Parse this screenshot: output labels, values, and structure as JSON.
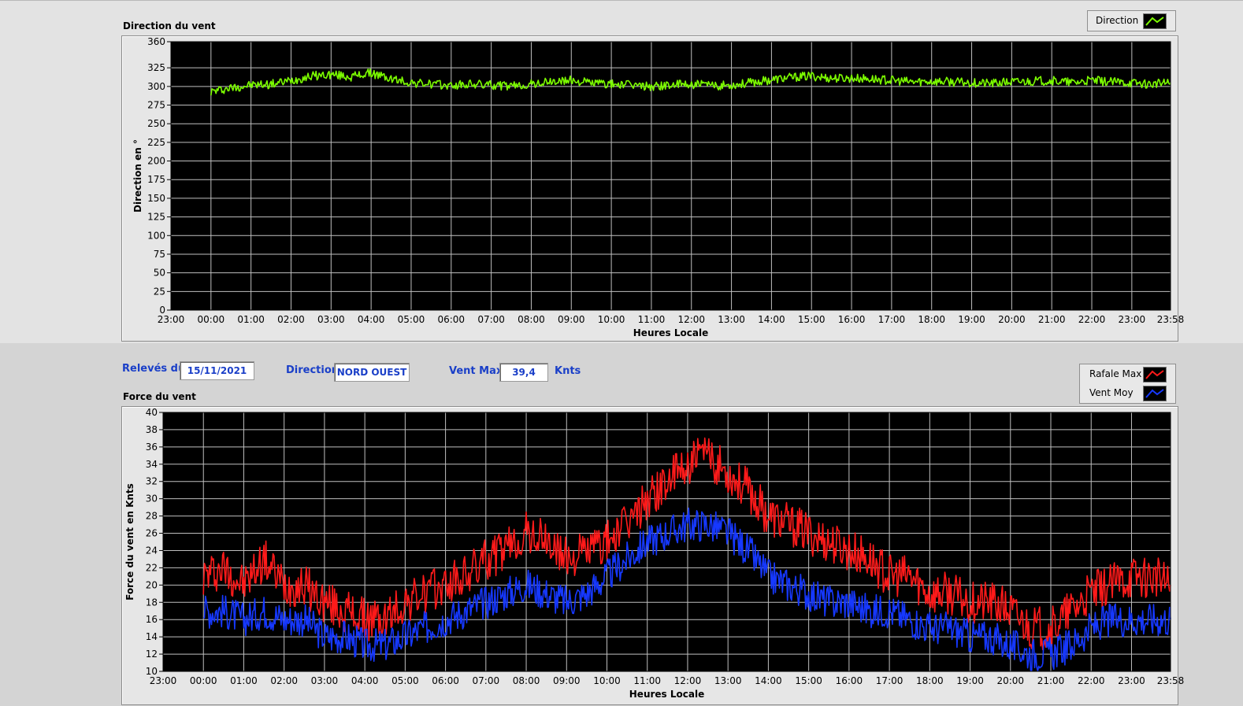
{
  "info": {
    "releves_label": "Relevés du",
    "date_value": "15/11/2021",
    "direction_label": "Direction",
    "direction_value": "NORD OUEST",
    "ventmax_label": "Vent Max",
    "ventmax_value": "39,4",
    "unit_label": "Knts"
  },
  "colors": {
    "plot_bg": "#000000",
    "grid": "#bfbfbf",
    "direction": "#7cfc00",
    "rafale": "#ff1a1a",
    "ventmoy": "#1638ff"
  },
  "chart_data": [
    {
      "type": "line",
      "title": "Direction du vent",
      "xlabel": "Heures Locale",
      "ylabel": "Direction en °",
      "ylim": [
        0,
        360
      ],
      "yticks": [
        0,
        25,
        50,
        75,
        100,
        125,
        150,
        175,
        200,
        225,
        250,
        275,
        300,
        325,
        360
      ],
      "xlim_hours": [
        -1,
        23.967
      ],
      "xticks": [
        {
          "h": -1,
          "label": "23:00"
        },
        {
          "h": 0,
          "label": "00:00"
        },
        {
          "h": 1,
          "label": "01:00"
        },
        {
          "h": 2,
          "label": "02:00"
        },
        {
          "h": 3,
          "label": "03:00"
        },
        {
          "h": 4,
          "label": "04:00"
        },
        {
          "h": 5,
          "label": "05:00"
        },
        {
          "h": 6,
          "label": "06:00"
        },
        {
          "h": 7,
          "label": "07:00"
        },
        {
          "h": 8,
          "label": "08:00"
        },
        {
          "h": 9,
          "label": "09:00"
        },
        {
          "h": 10,
          "label": "10:00"
        },
        {
          "h": 11,
          "label": "11:00"
        },
        {
          "h": 12,
          "label": "12:00"
        },
        {
          "h": 13,
          "label": "13:00"
        },
        {
          "h": 14,
          "label": "14:00"
        },
        {
          "h": 15,
          "label": "15:00"
        },
        {
          "h": 16,
          "label": "16:00"
        },
        {
          "h": 17,
          "label": "17:00"
        },
        {
          "h": 18,
          "label": "18:00"
        },
        {
          "h": 19,
          "label": "19:00"
        },
        {
          "h": 20,
          "label": "20:00"
        },
        {
          "h": 21,
          "label": "21:00"
        },
        {
          "h": 22,
          "label": "22:00"
        },
        {
          "h": 23,
          "label": "23:00"
        },
        {
          "h": 23.967,
          "label": "23:58"
        }
      ],
      "grid": true,
      "legend_position": "top-right",
      "series": [
        {
          "name": "Direction",
          "x_hours": [
            0,
            0.5,
            1,
            1.5,
            2,
            2.5,
            3,
            3.5,
            4,
            4.5,
            5,
            5.5,
            6,
            6.5,
            7,
            7.5,
            8,
            8.5,
            9,
            9.5,
            10,
            10.5,
            11,
            11.5,
            12,
            12.5,
            13,
            13.5,
            14,
            14.5,
            15,
            15.5,
            16,
            16.5,
            17,
            17.5,
            18,
            18.5,
            19,
            19.5,
            20,
            20.5,
            21,
            21.5,
            22,
            22.5,
            23,
            23.5,
            23.967
          ],
          "values": [
            293,
            298,
            302,
            303,
            308,
            314,
            316,
            313,
            318,
            310,
            305,
            303,
            301,
            303,
            302,
            300,
            303,
            306,
            308,
            305,
            303,
            302,
            300,
            302,
            303,
            301,
            302,
            305,
            309,
            312,
            314,
            311,
            311,
            310,
            308,
            306,
            307,
            306,
            305,
            304,
            306,
            307,
            308,
            305,
            308,
            306,
            305,
            303,
            305
          ]
        }
      ]
    },
    {
      "type": "line",
      "title": "Force du vent",
      "xlabel": "Heures Locale",
      "ylabel": "Force du vent en Knts",
      "ylim": [
        10,
        40
      ],
      "yticks": [
        10,
        12,
        14,
        16,
        18,
        20,
        22,
        24,
        26,
        28,
        30,
        32,
        34,
        36,
        38,
        40
      ],
      "xlim_hours": [
        -1,
        23.967
      ],
      "xticks": [
        {
          "h": -1,
          "label": "23:00"
        },
        {
          "h": 0,
          "label": "00:00"
        },
        {
          "h": 1,
          "label": "01:00"
        },
        {
          "h": 2,
          "label": "02:00"
        },
        {
          "h": 3,
          "label": "03:00"
        },
        {
          "h": 4,
          "label": "04:00"
        },
        {
          "h": 5,
          "label": "05:00"
        },
        {
          "h": 6,
          "label": "06:00"
        },
        {
          "h": 7,
          "label": "07:00"
        },
        {
          "h": 8,
          "label": "08:00"
        },
        {
          "h": 9,
          "label": "09:00"
        },
        {
          "h": 10,
          "label": "10:00"
        },
        {
          "h": 11,
          "label": "11:00"
        },
        {
          "h": 12,
          "label": "12:00"
        },
        {
          "h": 13,
          "label": "13:00"
        },
        {
          "h": 14,
          "label": "14:00"
        },
        {
          "h": 15,
          "label": "15:00"
        },
        {
          "h": 16,
          "label": "16:00"
        },
        {
          "h": 17,
          "label": "17:00"
        },
        {
          "h": 18,
          "label": "18:00"
        },
        {
          "h": 19,
          "label": "19:00"
        },
        {
          "h": 20,
          "label": "20:00"
        },
        {
          "h": 21,
          "label": "21:00"
        },
        {
          "h": 22,
          "label": "22:00"
        },
        {
          "h": 23,
          "label": "23:00"
        },
        {
          "h": 23.967,
          "label": "23:58"
        }
      ],
      "grid": true,
      "legend_position": "top-right",
      "series": [
        {
          "name": "Rafale Max",
          "x_hours": [
            0,
            0.5,
            1,
            1.5,
            2,
            2.5,
            3,
            3.5,
            4,
            4.5,
            5,
            5.5,
            6,
            6.5,
            7,
            7.5,
            8,
            8.5,
            9,
            9.5,
            10,
            10.5,
            11,
            11.5,
            12,
            12.5,
            13,
            13.5,
            14,
            14.5,
            15,
            15.5,
            16,
            16.5,
            17,
            17.5,
            18,
            18.5,
            19,
            19.5,
            20,
            20.5,
            21,
            21.5,
            22,
            22.5,
            23,
            23.5,
            23.967
          ],
          "values": [
            21,
            22,
            20,
            23,
            20,
            20,
            18,
            17,
            16,
            16,
            18,
            19,
            20,
            21,
            23,
            24,
            26,
            25,
            23,
            24,
            25,
            27,
            30,
            32,
            34,
            35,
            33,
            31,
            28,
            27,
            26,
            25,
            24,
            23,
            21,
            21,
            19,
            19,
            18,
            18,
            17,
            15,
            15,
            17,
            19,
            20,
            21,
            21,
            20
          ]
        },
        {
          "name": "Vent Moy",
          "x_hours": [
            0,
            0.5,
            1,
            1.5,
            2,
            2.5,
            3,
            3.5,
            4,
            4.5,
            5,
            5.5,
            6,
            6.5,
            7,
            7.5,
            8,
            8.5,
            9,
            9.5,
            10,
            10.5,
            11,
            11.5,
            12,
            12.5,
            13,
            13.5,
            14,
            14.5,
            15,
            15.5,
            16,
            16.5,
            17,
            17.5,
            18,
            18.5,
            19,
            19.5,
            20,
            20.5,
            21,
            21.5,
            22,
            22.5,
            23,
            23.5,
            23.967
          ],
          "values": [
            17,
            17,
            16,
            17,
            16,
            16,
            14,
            14,
            13,
            13,
            14,
            15,
            16,
            17,
            18,
            19,
            20,
            19,
            18,
            19,
            21,
            23,
            25,
            26,
            27,
            27,
            26,
            24,
            21,
            20,
            19,
            18,
            18,
            17,
            17,
            16,
            15,
            15,
            14,
            14,
            13,
            12,
            12,
            13,
            15,
            16,
            16,
            16,
            16
          ]
        }
      ]
    }
  ]
}
